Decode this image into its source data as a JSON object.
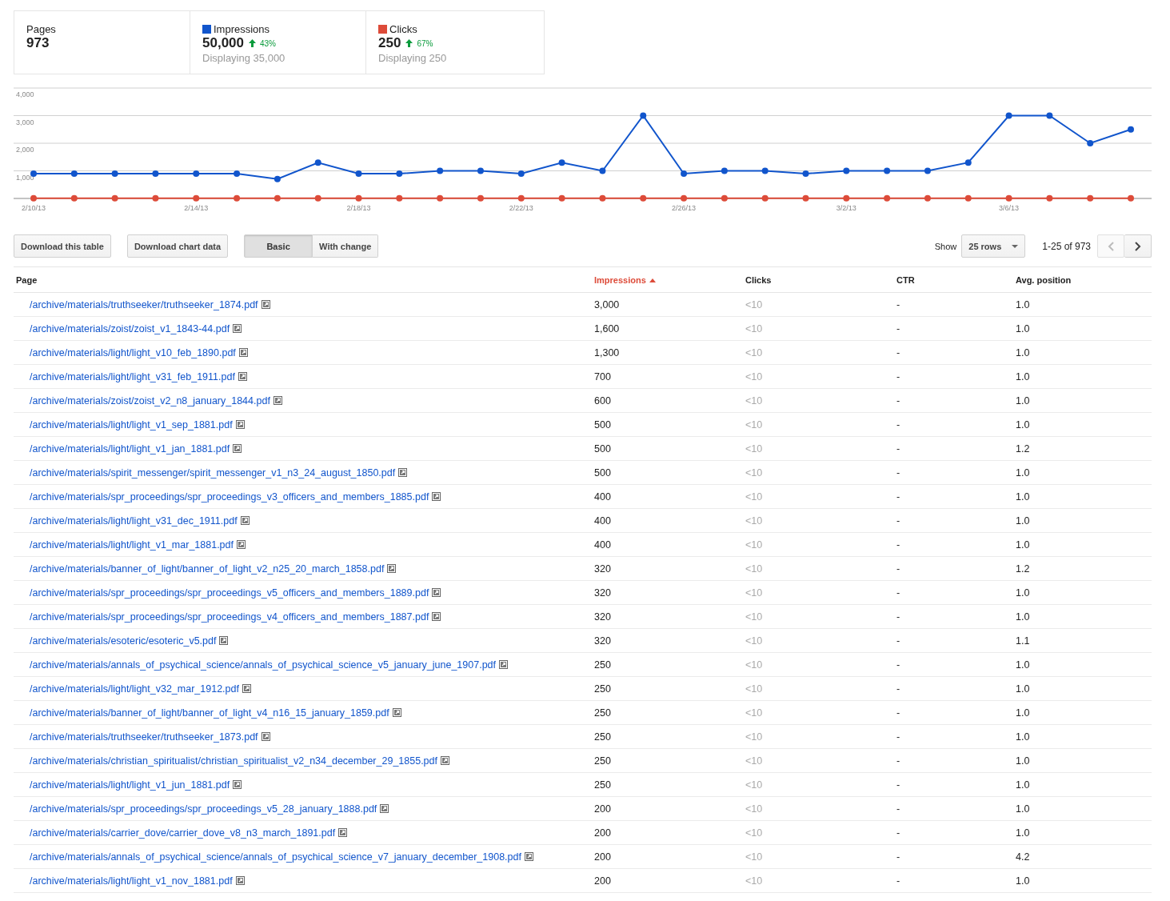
{
  "summary": [
    {
      "label": "Pages",
      "value": "973"
    },
    {
      "label": "Impressions",
      "color": "#1155cc",
      "value": "50,000",
      "change": "43%",
      "note": "Displaying 35,000"
    },
    {
      "label": "Clicks",
      "color": "#dd4b39",
      "value": "250",
      "change": "67%",
      "note": "Displaying 250"
    }
  ],
  "chart_data": {
    "type": "line",
    "grid": true,
    "categories": [
      "2/10/13",
      null,
      null,
      null,
      "2/14/13",
      null,
      null,
      null,
      "2/18/13",
      null,
      null,
      null,
      "2/22/13",
      null,
      null,
      null,
      "2/26/13",
      null,
      null,
      null,
      "3/2/13",
      null,
      null,
      null,
      "3/6/13",
      null,
      null,
      null
    ],
    "series": [
      {
        "color": "#1155cc",
        "marker": "circle",
        "values": [
          900,
          900,
          900,
          900,
          900,
          900,
          700,
          1300,
          900,
          900,
          1000,
          1000,
          900,
          1300,
          1000,
          3000,
          900,
          1000,
          1000,
          900,
          1000,
          1000,
          1000,
          1300,
          3000,
          3000,
          2000,
          2500
        ]
      },
      {
        "color": "#dd4b39",
        "marker": "circle",
        "values": [
          10,
          10,
          10,
          10,
          10,
          10,
          10,
          10,
          10,
          10,
          10,
          10,
          10,
          10,
          10,
          10,
          10,
          10,
          10,
          10,
          10,
          10,
          10,
          10,
          10,
          10,
          10,
          10
        ]
      }
    ],
    "ylim": [
      0,
      4000
    ],
    "yticks": [
      {
        "value": 1000,
        "label": "1,000"
      },
      {
        "value": 2000,
        "label": "2,000"
      },
      {
        "value": 3000,
        "label": "3,000"
      },
      {
        "value": 4000,
        "label": "4,000"
      }
    ]
  },
  "toolbar": {
    "buttons": [
      "Download this table",
      "Download chart data"
    ],
    "views": [
      {
        "label": "Basic",
        "selected": true
      },
      {
        "label": "With change",
        "selected": false
      }
    ],
    "show_label": "Show",
    "rows_select": "25 rows",
    "range": "1-25 of 973",
    "prev_disabled": true
  },
  "table": {
    "columns": [
      {
        "label": "Page",
        "sorted": false
      },
      {
        "label": "Impressions",
        "sorted": true
      },
      {
        "label": "Clicks",
        "sorted": false
      },
      {
        "label": "CTR",
        "sorted": false
      },
      {
        "label": "Avg. position",
        "sorted": false
      }
    ],
    "rows": [
      [
        "/archive/materials/truthseeker/truthseeker_1874.pdf",
        "3,000",
        "<10",
        "-",
        "1.0"
      ],
      [
        "/archive/materials/zoist/zoist_v1_1843-44.pdf",
        "1,600",
        "<10",
        "-",
        "1.0"
      ],
      [
        "/archive/materials/light/light_v10_feb_1890.pdf",
        "1,300",
        "<10",
        "-",
        "1.0"
      ],
      [
        "/archive/materials/light/light_v31_feb_1911.pdf",
        "700",
        "<10",
        "-",
        "1.0"
      ],
      [
        "/archive/materials/zoist/zoist_v2_n8_january_1844.pdf",
        "600",
        "<10",
        "-",
        "1.0"
      ],
      [
        "/archive/materials/light/light_v1_sep_1881.pdf",
        "500",
        "<10",
        "-",
        "1.0"
      ],
      [
        "/archive/materials/light/light_v1_jan_1881.pdf",
        "500",
        "<10",
        "-",
        "1.2"
      ],
      [
        "/archive/materials/spirit_messenger/spirit_messenger_v1_n3_24_august_1850.pdf",
        "500",
        "<10",
        "-",
        "1.0"
      ],
      [
        "/archive/materials/spr_proceedings/spr_proceedings_v3_officers_and_members_1885.pdf",
        "400",
        "<10",
        "-",
        "1.0"
      ],
      [
        "/archive/materials/light/light_v31_dec_1911.pdf",
        "400",
        "<10",
        "-",
        "1.0"
      ],
      [
        "/archive/materials/light/light_v1_mar_1881.pdf",
        "400",
        "<10",
        "-",
        "1.0"
      ],
      [
        "/archive/materials/banner_of_light/banner_of_light_v2_n25_20_march_1858.pdf",
        "320",
        "<10",
        "-",
        "1.2"
      ],
      [
        "/archive/materials/spr_proceedings/spr_proceedings_v5_officers_and_members_1889.pdf",
        "320",
        "<10",
        "-",
        "1.0"
      ],
      [
        "/archive/materials/spr_proceedings/spr_proceedings_v4_officers_and_members_1887.pdf",
        "320",
        "<10",
        "-",
        "1.0"
      ],
      [
        "/archive/materials/esoteric/esoteric_v5.pdf",
        "320",
        "<10",
        "-",
        "1.1"
      ],
      [
        "/archive/materials/annals_of_psychical_science/annals_of_psychical_science_v5_january_june_1907.pdf",
        "250",
        "<10",
        "-",
        "1.0"
      ],
      [
        "/archive/materials/light/light_v32_mar_1912.pdf",
        "250",
        "<10",
        "-",
        "1.0"
      ],
      [
        "/archive/materials/banner_of_light/banner_of_light_v4_n16_15_january_1859.pdf",
        "250",
        "<10",
        "-",
        "1.0"
      ],
      [
        "/archive/materials/truthseeker/truthseeker_1873.pdf",
        "250",
        "<10",
        "-",
        "1.0"
      ],
      [
        "/archive/materials/christian_spiritualist/christian_spiritualist_v2_n34_december_29_1855.pdf",
        "250",
        "<10",
        "-",
        "1.0"
      ],
      [
        "/archive/materials/light/light_v1_jun_1881.pdf",
        "250",
        "<10",
        "-",
        "1.0"
      ],
      [
        "/archive/materials/spr_proceedings/spr_proceedings_v5_28_january_1888.pdf",
        "200",
        "<10",
        "-",
        "1.0"
      ],
      [
        "/archive/materials/carrier_dove/carrier_dove_v8_n3_march_1891.pdf",
        "200",
        "<10",
        "-",
        "1.0"
      ],
      [
        "/archive/materials/annals_of_psychical_science/annals_of_psychical_science_v7_january_december_1908.pdf",
        "200",
        "<10",
        "-",
        "4.2"
      ],
      [
        "/archive/materials/light/light_v1_nov_1881.pdf",
        "200",
        "<10",
        "-",
        "1.0"
      ]
    ]
  }
}
